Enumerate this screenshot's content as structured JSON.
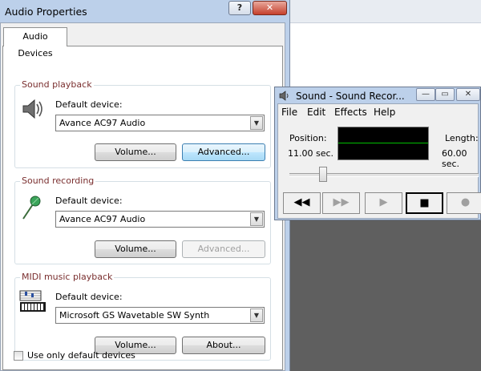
{
  "audio_properties": {
    "title": "Audio Properties",
    "help_glyph": "?",
    "close_glyph": "✕",
    "tab": "Audio Devices",
    "sound_playback": {
      "group_label": "Sound playback",
      "default_device_label": "Default device:",
      "device": "Avance AC97 Audio",
      "volume_button": "Volume...",
      "advanced_button": "Advanced..."
    },
    "sound_recording": {
      "group_label": "Sound recording",
      "default_device_label": "Default device:",
      "device": "Avance AC97 Audio",
      "volume_button": "Volume...",
      "advanced_button": "Advanced..."
    },
    "midi_playback": {
      "group_label": "MIDI music playback",
      "default_device_label": "Default device:",
      "device": "Microsoft GS Wavetable SW Synth",
      "volume_button": "Volume...",
      "about_button": "About..."
    },
    "use_only_default_label": "Use only default devices"
  },
  "sound_recorder": {
    "title": "Sound - Sound Recor...",
    "menu": [
      "File",
      "Edit",
      "Effects",
      "Help"
    ],
    "position_label": "Position:",
    "position_value": "11.00 sec.",
    "length_label": "Length:",
    "length_value": "60.00 sec.",
    "slider_position": 0.18,
    "transport_glyphs": {
      "rewind": "◀◀",
      "forward": "▶▶",
      "play": "▶",
      "stop": "■",
      "record": "●"
    }
  },
  "colors": {
    "waveform_line": "#00c000",
    "group_label": "#7a2f2f",
    "title_bar": "#bcd0ea"
  }
}
